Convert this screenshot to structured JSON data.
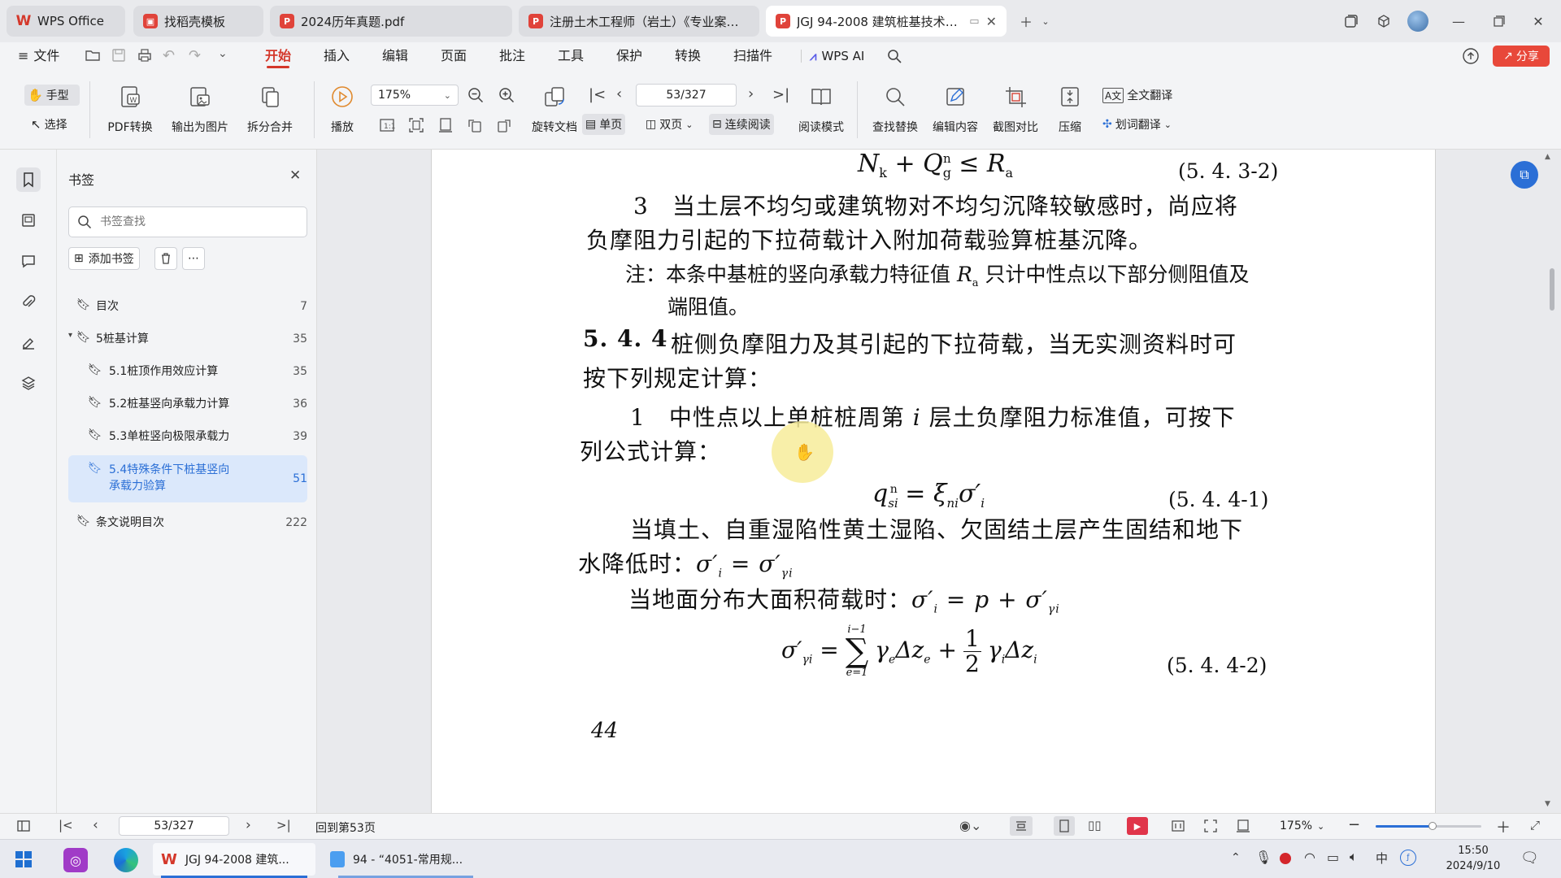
{
  "colors": {
    "accent": "#d4382b",
    "link_blue": "#2b6fd6",
    "selected_bg": "#dbe8fb",
    "pointer_highlight": "#f7ec9a"
  },
  "tabs": [
    {
      "label": "WPS Office",
      "icon": "wps-logo-icon"
    },
    {
      "label": "找稻壳模板",
      "icon": "docer-icon"
    },
    {
      "label": "2024历年真题.pdf",
      "icon": "pdf-icon"
    },
    {
      "label": "注册土木工程师（岩土）《专业案例》",
      "icon": "pdf-icon"
    },
    {
      "label": "JGJ 94-2008 建筑桩基技术规范",
      "icon": "pdf-icon"
    }
  ],
  "menu": {
    "file": "文件",
    "items": [
      "开始",
      "插入",
      "编辑",
      "页面",
      "批注",
      "工具",
      "保护",
      "转换",
      "扫描件"
    ],
    "wps_ai": "WPS AI",
    "share": "分享"
  },
  "ribbon": {
    "hand": "手型",
    "select": "选择",
    "pdf_convert": "PDF转换",
    "export_image": "输出为图片",
    "split_merge": "拆分合并",
    "play": "播放",
    "zoom_value": "175%",
    "page_value": "53/327",
    "rotate": "旋转文档",
    "single_page": "单页",
    "double_page": "双页",
    "continuous": "连续阅读",
    "read_mode": "阅读模式",
    "find_replace": "查找替换",
    "edit_content": "编辑内容",
    "screenshot_compare": "截图对比",
    "compress": "压缩",
    "full_translate": "全文翻译",
    "word_translate": "划词翻译"
  },
  "sidebar": {
    "title": "书签",
    "search_placeholder": "书签查找",
    "add_bookmark": "添加书签",
    "items": [
      {
        "label": "目次",
        "page": "7"
      },
      {
        "label": "5桩基计算",
        "page": "35"
      },
      {
        "label": "5.1桩顶作用效应计算",
        "page": "35"
      },
      {
        "label": "5.2桩基竖向承载力计算",
        "page": "36"
      },
      {
        "label": "5.3单桩竖向极限承载力",
        "page": "39"
      },
      {
        "label": "5.4特殊条件下桩基竖向承载力验算",
        "page": "51"
      },
      {
        "label": "条文说明目次",
        "page": "222"
      }
    ]
  },
  "document": {
    "eq_532_label": "(5. 4. 3-2)",
    "para3_line1": "3　当土层不均匀或建筑物对不均匀沉降较敏感时，尚应将",
    "para3_line2": "负摩阻力引起的下拉荷载计入附加荷载验算桩基沉降。",
    "note_line1_a": "注：本条中基桩的竖向承载力特征值",
    "note_line1_b": "只计中性点以下部分侧阻值及",
    "note_line2": "端阻值。",
    "sec_number": "5. 4. 4",
    "sec_line1": "桩侧负摩阻力及其引起的下拉荷载，当无实测资料时可",
    "sec_line2": "按下列规定计算：",
    "item1_a": "1　中性点以上单桩桩周第",
    "item1_b": "层土负摩阻力标准值，可按下",
    "item1_line2": "列公式计算：",
    "eq_441_label": "(5. 4. 4-1)",
    "fill_line1": "当填土、自重湿陷性黄土湿陷、欠固结土层产生固结和地下",
    "fill_line2": "水降低时：",
    "load_line": "当地面分布大面积荷载时：",
    "eq_442_label": "(5. 4. 4-2)",
    "page_number": "44"
  },
  "statusbar": {
    "page_value": "53/327",
    "back_to": "回到第53页",
    "zoom": "175%"
  },
  "taskbar": {
    "app1": "JGJ 94-2008 建筑...",
    "app2": "94 - “4051-常用规...",
    "time": "15:50",
    "date": "2024/9/10",
    "ime": "中"
  }
}
